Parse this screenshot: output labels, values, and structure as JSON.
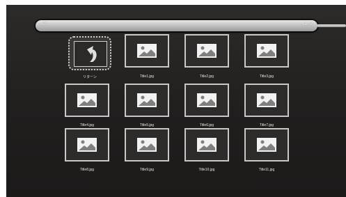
{
  "pathbar": {
    "path": "C/",
    "page": "1 / 2"
  },
  "items": [
    {
      "label": "リターン",
      "kind": "back"
    },
    {
      "label": "Title1.jpg"
    },
    {
      "label": "Title2.jpg"
    },
    {
      "label": "Title3.jpg"
    },
    {
      "label": "Title4.jpg"
    },
    {
      "label": "Title5.jpg"
    },
    {
      "label": "Title6.jpg"
    },
    {
      "label": "Title7.jpg"
    },
    {
      "label": "Title8.jpg"
    },
    {
      "label": "Title9.jpg"
    },
    {
      "label": "Title10.jpg"
    },
    {
      "label": "Title11.jpg"
    }
  ],
  "icons": {
    "back": "return-arrow-icon",
    "image": "image-placeholder-icon"
  }
}
